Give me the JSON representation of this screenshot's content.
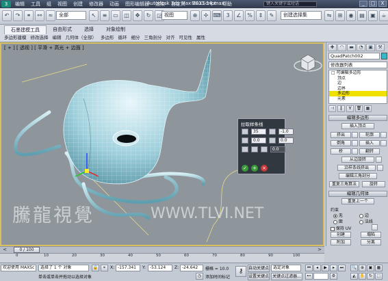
{
  "titlebar": {
    "logo": "3",
    "menu": [
      "编辑",
      "工具",
      "组",
      "视图",
      "创建",
      "修改器",
      "动画",
      "图形编辑器",
      "渲染",
      "自定义",
      "MAXScript",
      "帮助"
    ],
    "app_title": "Autodesk 3ds Max  2011       14.max",
    "search_placeholder": "键入关键字或短语",
    "window_buttons": [
      "_",
      "□",
      "X"
    ]
  },
  "toolbar": {
    "selection_filter": "全部",
    "ref_coord": "视图",
    "named_selection": "创建选择集"
  },
  "ribbon": {
    "tabs": [
      "石墨建模工具",
      "自由形式",
      "选择",
      "对象绘制"
    ],
    "sub_items": [
      "多边形建模",
      "修改选择",
      "编辑",
      "几何体（全部）",
      "多边形",
      "循环",
      "细分",
      "三角剖分",
      "对齐",
      "可见性",
      "属性"
    ]
  },
  "viewport": {
    "label": "[ + ] [ 透视 ] [ 平滑 + 高光 + 边面 ]"
  },
  "caddy": {
    "title": "拉取样条线",
    "segments": "35",
    "taper": "-1.0",
    "taper_curve": "0.0",
    "twist": "0.0",
    "rotation": "0.0",
    "buttons": [
      "✓",
      "+",
      "×"
    ]
  },
  "cmdpanel": {
    "tabs": [
      "✚",
      "◠",
      "▬",
      "◔",
      "▣",
      "⚒"
    ],
    "object_name": "QuadPatch002",
    "object_color": "#3ab6c8",
    "modifier_list": "修改器列表",
    "stack": [
      {
        "label": "□ 可编辑多边形",
        "sub": false,
        "selected": false
      },
      {
        "label": "顶点",
        "sub": true,
        "selected": false
      },
      {
        "label": "边",
        "sub": true,
        "selected": false
      },
      {
        "label": "边界",
        "sub": true,
        "selected": false
      },
      {
        "label": "多边形",
        "sub": true,
        "selected": true
      },
      {
        "label": "元素",
        "sub": true,
        "selected": false
      }
    ],
    "rollout_edit_poly": "编辑多边形",
    "insert_vertex": "插入顶点",
    "extrude": "挤出",
    "outline": "轮廓",
    "bevel": "倒角",
    "inset": "插入",
    "bridge": "桥",
    "flip": "翻转",
    "hinge": "从边旋转",
    "extrude_spline": "沿样条线挤出",
    "edit_tri": "编辑三角剖分",
    "retriangulate": "重复三角算法",
    "turn": "旋转",
    "rollout_edit_geo": "编辑几何体",
    "repeat_last": "重复上一个",
    "constraints_label": "约束",
    "constraint_none": "无",
    "constraint_edge": "边",
    "constraint_face": "面",
    "constraint_normal": "法线",
    "preserve_uvs": "保持 UV",
    "create": "创建",
    "collapse": "塌陷",
    "attach": "附加",
    "detach": "分离",
    "slice_plane": "切片平面",
    "split": "分割"
  },
  "timeslider": {
    "position": "0 / 100",
    "prev": "<",
    "next": ">"
  },
  "track": {
    "ticks": [
      "0",
      "10",
      "20",
      "30",
      "40",
      "50",
      "60",
      "70",
      "80",
      "90",
      "100"
    ]
  },
  "status": {
    "maxscript": "欢迎使用 MAXSc",
    "selection": "选择了 1 个 对象",
    "prompt": "单击或单击并拖动以选择对象",
    "x_label": "X:",
    "x_value": "-157.341",
    "y_label": "Y:",
    "y_value": "-53.124",
    "z_label": "Z:",
    "z_value": "-24.642",
    "grid": "栅格 = 10.0",
    "add_time_tag": "添加时间标记",
    "auto_key": "自动关键点",
    "set_key": "设置关键点",
    "selected_obj": "选定对象",
    "key_filters": "关键点过滤器..."
  },
  "watermark": {
    "chinese": "騰龍視覺",
    "latin": "WWW.TLVI.NET"
  }
}
